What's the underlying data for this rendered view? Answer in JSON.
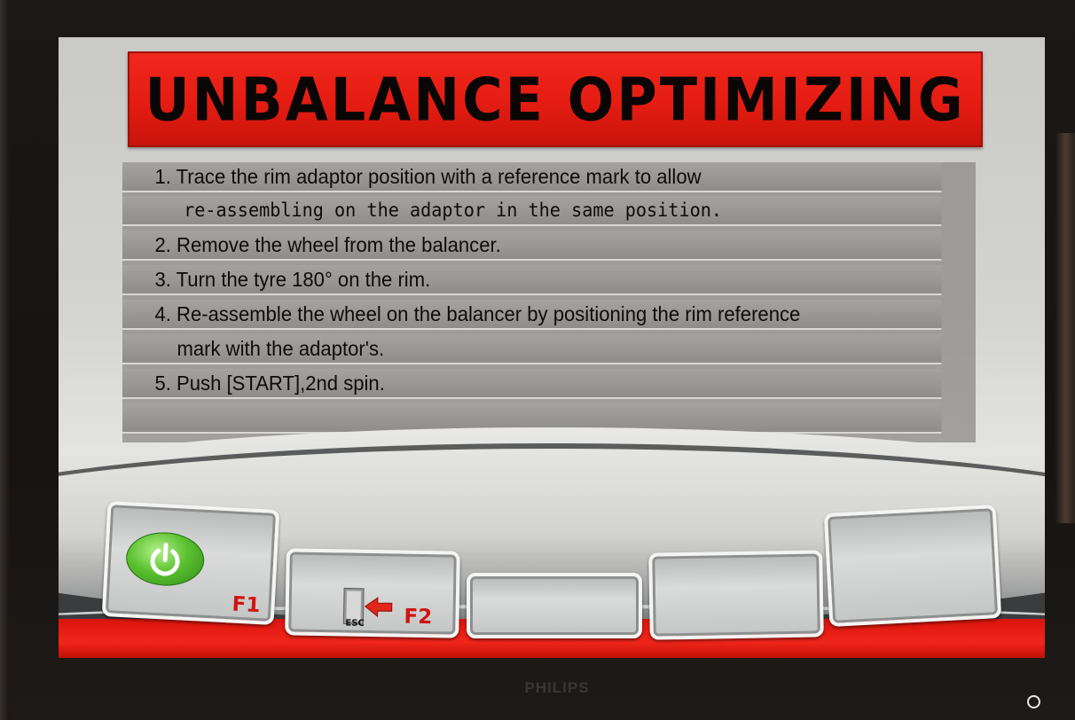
{
  "screen": {
    "title": "UNBALANCE OPTIMIZING",
    "instructions": [
      "1. Trace the rim adaptor position with a reference mark to allow",
      "re-assembling on the adaptor in the same position.",
      "2. Remove the wheel from the balancer.",
      "3. Turn the tyre 180° on the rim.",
      "4. Re-assemble the wheel on the balancer by positioning the rim reference",
      "mark with the adaptor's.",
      "5. Push [START],2nd spin.",
      ""
    ]
  },
  "function_keys": [
    {
      "key": "F1",
      "icon": "power-icon"
    },
    {
      "key": "F2",
      "icon": "exit-door-icon",
      "icon_text": "ESC"
    },
    {
      "key": "",
      "icon": ""
    },
    {
      "key": "",
      "icon": ""
    },
    {
      "key": "",
      "icon": ""
    }
  ],
  "monitor": {
    "brand": "PHILIPS"
  },
  "colors": {
    "banner_red": "#e41c12",
    "key_label_red": "#cf1510",
    "power_green": "#5cc231"
  }
}
